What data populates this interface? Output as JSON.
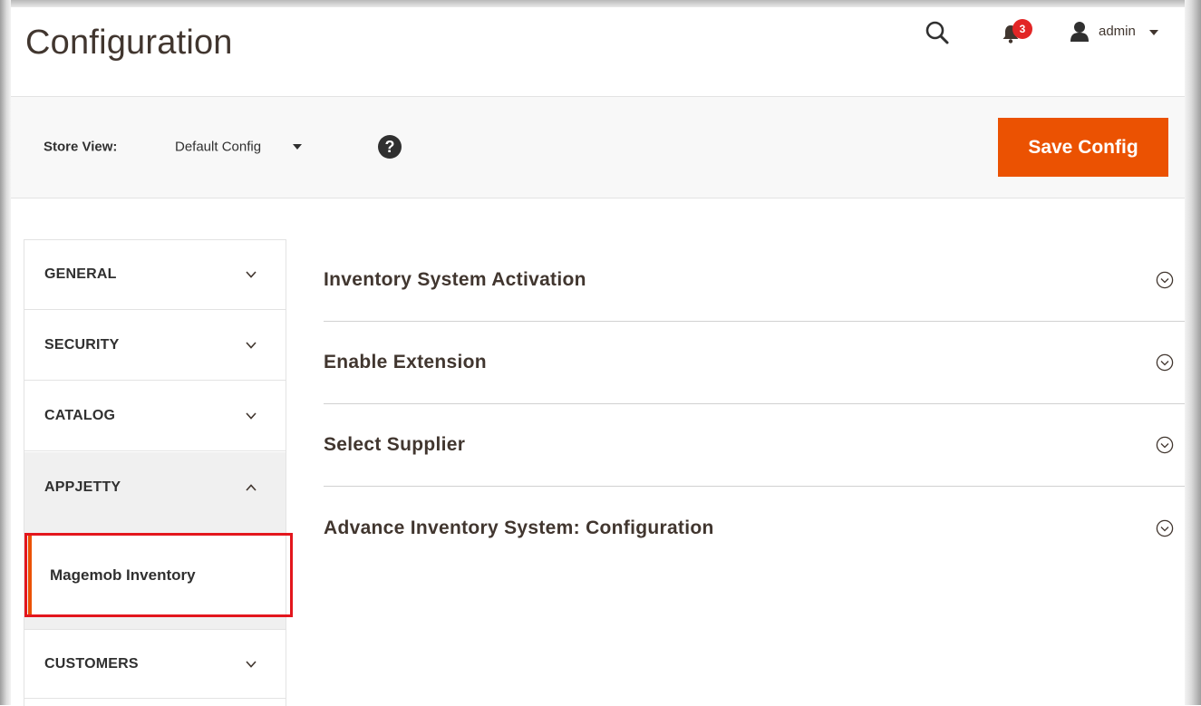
{
  "header": {
    "title": "Configuration",
    "notifications_count": "3",
    "user_name": "admin"
  },
  "store_bar": {
    "label": "Store View:",
    "value": "Default Config",
    "help": "?",
    "save_label": "Save Config"
  },
  "sidebar": {
    "items": [
      {
        "label": "GENERAL"
      },
      {
        "label": "SECURITY"
      },
      {
        "label": "CATALOG"
      },
      {
        "label": "APPJETTY"
      },
      {
        "label": "CUSTOMERS"
      }
    ],
    "sub_item": "Magemob Inventory"
  },
  "sections": [
    {
      "label": "Inventory System Activation"
    },
    {
      "label": "Enable Extension"
    },
    {
      "label": "Select Supplier"
    },
    {
      "label": "Advance Inventory System: Configuration"
    }
  ],
  "colors": {
    "accent": "#eb5202",
    "badge": "#e22626",
    "highlight": "#e3161d"
  }
}
